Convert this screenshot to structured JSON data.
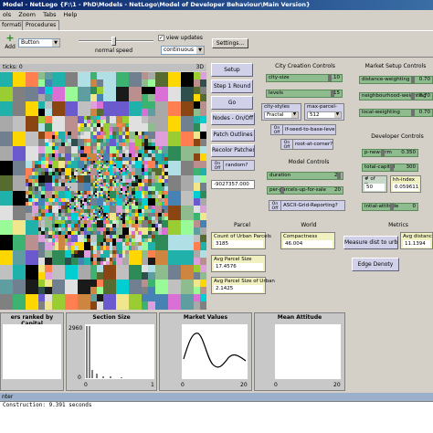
{
  "window": {
    "title": "Model - NetLogo {F:\\1 - PhD\\Models - NetLogo\\Model of Developer Behaviour\\Main Version}"
  },
  "menu": [
    "ols",
    "Zoom",
    "Tabs",
    "Help"
  ],
  "tabs": [
    "formation",
    "Procedures"
  ],
  "toolbar": {
    "add_label": "Add",
    "widget_type": "Button",
    "speed_label": "normal speed",
    "view_updates_label": "view updates",
    "view_updates_checked": "✓",
    "update_mode": "continuous",
    "settings_label": "Settings..."
  },
  "view": {
    "ticks_label": "ticks: 0",
    "three_d": "3D"
  },
  "buttons": {
    "setup": "Setup",
    "step": "Step 1 Round",
    "go": "Go",
    "nodes": "Nodes - On/Off",
    "patch_outlines": "Patch Outlines",
    "recolor": "Recolor Patches",
    "measure": "Measure dist to urban",
    "edge": "Edge Denoty"
  },
  "switches": {
    "random": {
      "state": "On\nOff",
      "label": "random?"
    },
    "seed": {
      "state": "On\nOff",
      "label": "if-seed-to-base-level"
    },
    "root_corner": {
      "state": "On\nOff",
      "label": "root-at-corner?"
    },
    "asci": {
      "state": "On\nOff",
      "label": "ASCII-Grid-Reporting?"
    }
  },
  "seed_monitor": "-9027357.000",
  "city": {
    "title": "City Creation Controls",
    "city_size": {
      "name": "city-size",
      "value": "1.10"
    },
    "levels": {
      "name": "levels",
      "value": "15"
    },
    "city_styles": {
      "name": "city-styles",
      "value": "Fractal"
    },
    "max_parcel": {
      "name": "max-parcel-size",
      "value": "512"
    }
  },
  "market": {
    "title": "Market Setup Controls",
    "distance": {
      "name": "distance-weighting",
      "value": "0.70"
    },
    "neighbourhood": {
      "name": "neighbourhood-weighting",
      "value": "0.70"
    },
    "local": {
      "name": "local-weighting",
      "value": "0.70"
    }
  },
  "model": {
    "title": "Model Controls",
    "duration": {
      "name": "duration",
      "value": "20"
    },
    "per_parcels": {
      "name": "per-parcels-up-for-sale",
      "value": "20"
    }
  },
  "developer": {
    "title": "Developer Controls",
    "p_new_firm": {
      "name": "p-new-firm",
      "value": "0.350"
    },
    "total_capital": {
      "name": "total-capital",
      "value": "300"
    },
    "num_devs": {
      "name": "# of Devs",
      "value": "50"
    },
    "hh_index": {
      "name": "hh-index",
      "value": "0.059611"
    },
    "initial_attitude": {
      "name": "intial-attitude",
      "value": "0"
    }
  },
  "parcel": {
    "title": "Parcel",
    "count_urban": {
      "name": "Count of Urban Parcels",
      "value": "3185"
    },
    "avg_size": {
      "name": "Avg Parcel Size",
      "value": "17.4576"
    },
    "avg_urban": {
      "name": "Avg Parcel Size of Urban",
      "value": "2.1425"
    }
  },
  "world": {
    "title": "World",
    "compactness": {
      "name": "Compactness",
      "value": "46.004"
    }
  },
  "metrics": {
    "title": "Metrics",
    "avg_dist": {
      "name": "Avg distanc",
      "value": "11.1394"
    }
  },
  "plots": {
    "ranked": {
      "title": "ers ranked by Capital"
    },
    "section": {
      "title": "Section Size",
      "ymax": "2960",
      "ymin": "0",
      "xmin": "0",
      "xmax": "1"
    },
    "market": {
      "title": "Market Values",
      "xmin": "0",
      "xmax": "20"
    },
    "attitude": {
      "title": "Mean Attitude",
      "xmin": "0",
      "xmax": "20"
    }
  },
  "command_center": {
    "title": "nter",
    "output": "Construction: 9.391 seconds"
  },
  "colors": {
    "button": "#d0d0e8",
    "slider": "#8fbc8f",
    "monitor": "#f0f0c0",
    "titlebar": "#0a246a"
  }
}
